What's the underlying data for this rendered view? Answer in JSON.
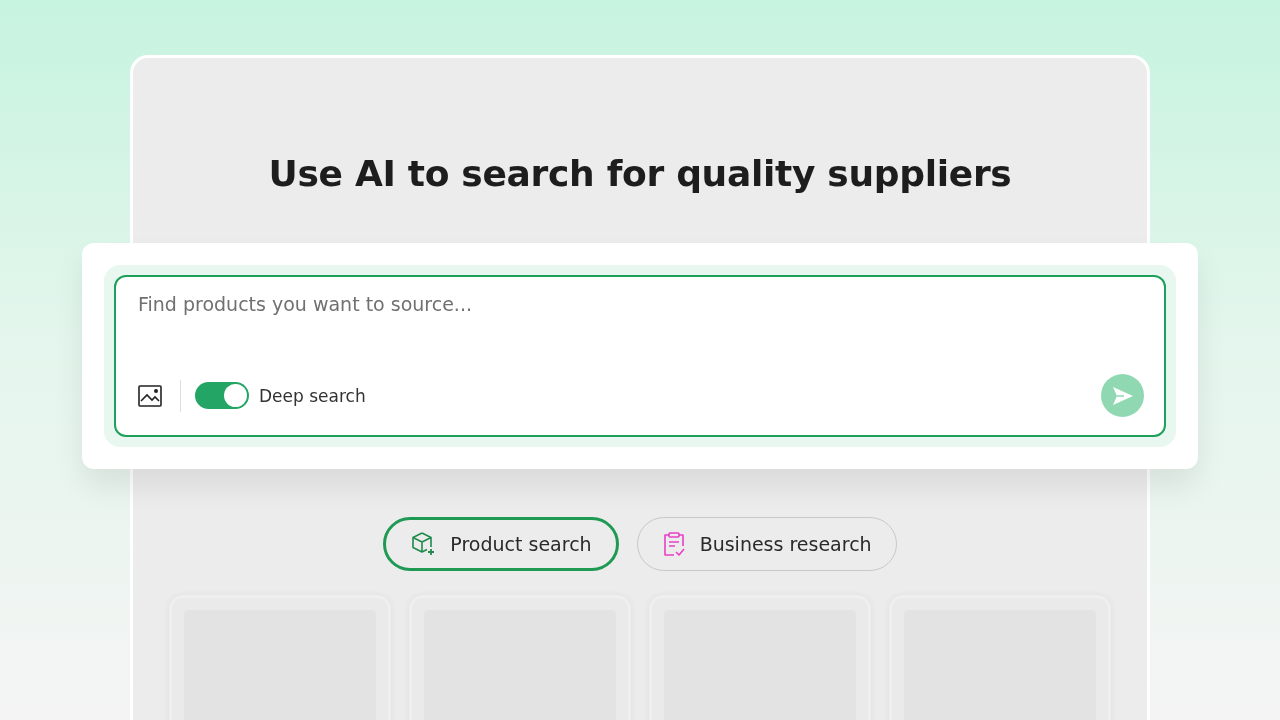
{
  "title": "Use AI to search for quality suppliers",
  "search": {
    "placeholder": "Find products you want to source...",
    "deep_search": {
      "label": "Deep search",
      "on": true
    }
  },
  "modes": [
    {
      "kind": "product",
      "label": "Product search",
      "selected": true
    },
    {
      "kind": "business",
      "label": "Business research",
      "selected": false
    }
  ]
}
